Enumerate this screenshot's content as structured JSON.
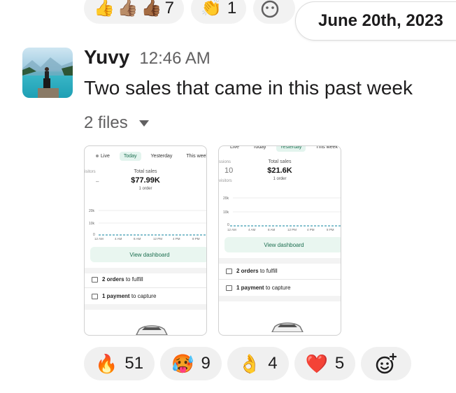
{
  "top_reactions": [
    {
      "emojis": [
        "👍",
        "👍🏽",
        "👍🏾"
      ],
      "count": "7"
    },
    {
      "emojis": [
        "👏"
      ],
      "count": "1"
    }
  ],
  "date_divider": "June 20th, 2023",
  "message": {
    "sender": "Yuvy",
    "time": "12:46 AM",
    "text": "Two sales that came in this past week",
    "files_label": "2 files"
  },
  "thumbnails": [
    {
      "tabs": [
        "Live",
        "Today",
        "Yesterday",
        "This week"
      ],
      "active_tab": "Today",
      "left_label": "isitors",
      "left_value": "–",
      "total_label": "Total sales",
      "total_value": "$77.99K",
      "orders": "1 order",
      "y_ticks": [
        "20k",
        "10k",
        "0"
      ],
      "x_ticks": [
        "12 AM",
        "4 AM",
        "8 AM",
        "12 PM",
        "4 PM",
        "8 PM"
      ],
      "button": "View dashboard",
      "task1_bold": "2 orders",
      "task1_rest": "to fulfill",
      "task2_bold": "1 payment",
      "task2_rest": "to capture"
    },
    {
      "tabs": [
        "Live",
        "Today",
        "Yesterday",
        "This week"
      ],
      "active_tab": "Yesterday",
      "left_label": "ssions",
      "left_value": "10",
      "left_sub": "visitors",
      "total_label": "Total sales",
      "total_value": "$21.6K",
      "orders": "1 order",
      "y_ticks": [
        "20k",
        "10k",
        "0"
      ],
      "x_ticks": [
        "12 AM",
        "4 AM",
        "8 AM",
        "12 PM",
        "4 PM",
        "8 PM"
      ],
      "button": "View dashboard",
      "task1_bold": "2 orders",
      "task1_rest": "to fulfill",
      "task2_bold": "1 payment",
      "task2_rest": "to capture"
    }
  ],
  "reactions": [
    {
      "emoji": "🔥",
      "count": "51"
    },
    {
      "emoji": "🥵",
      "count": "9"
    },
    {
      "emoji": "👌",
      "count": "4"
    },
    {
      "emoji": "❤️",
      "count": "5"
    }
  ],
  "icons": {
    "add_reaction": "add-reaction-icon",
    "caret": "caret-down-icon"
  },
  "colors": {
    "pill_bg": "#f0f0f0",
    "accent_green": "#1b6e4f",
    "chart_line": "#3a9ab0"
  }
}
